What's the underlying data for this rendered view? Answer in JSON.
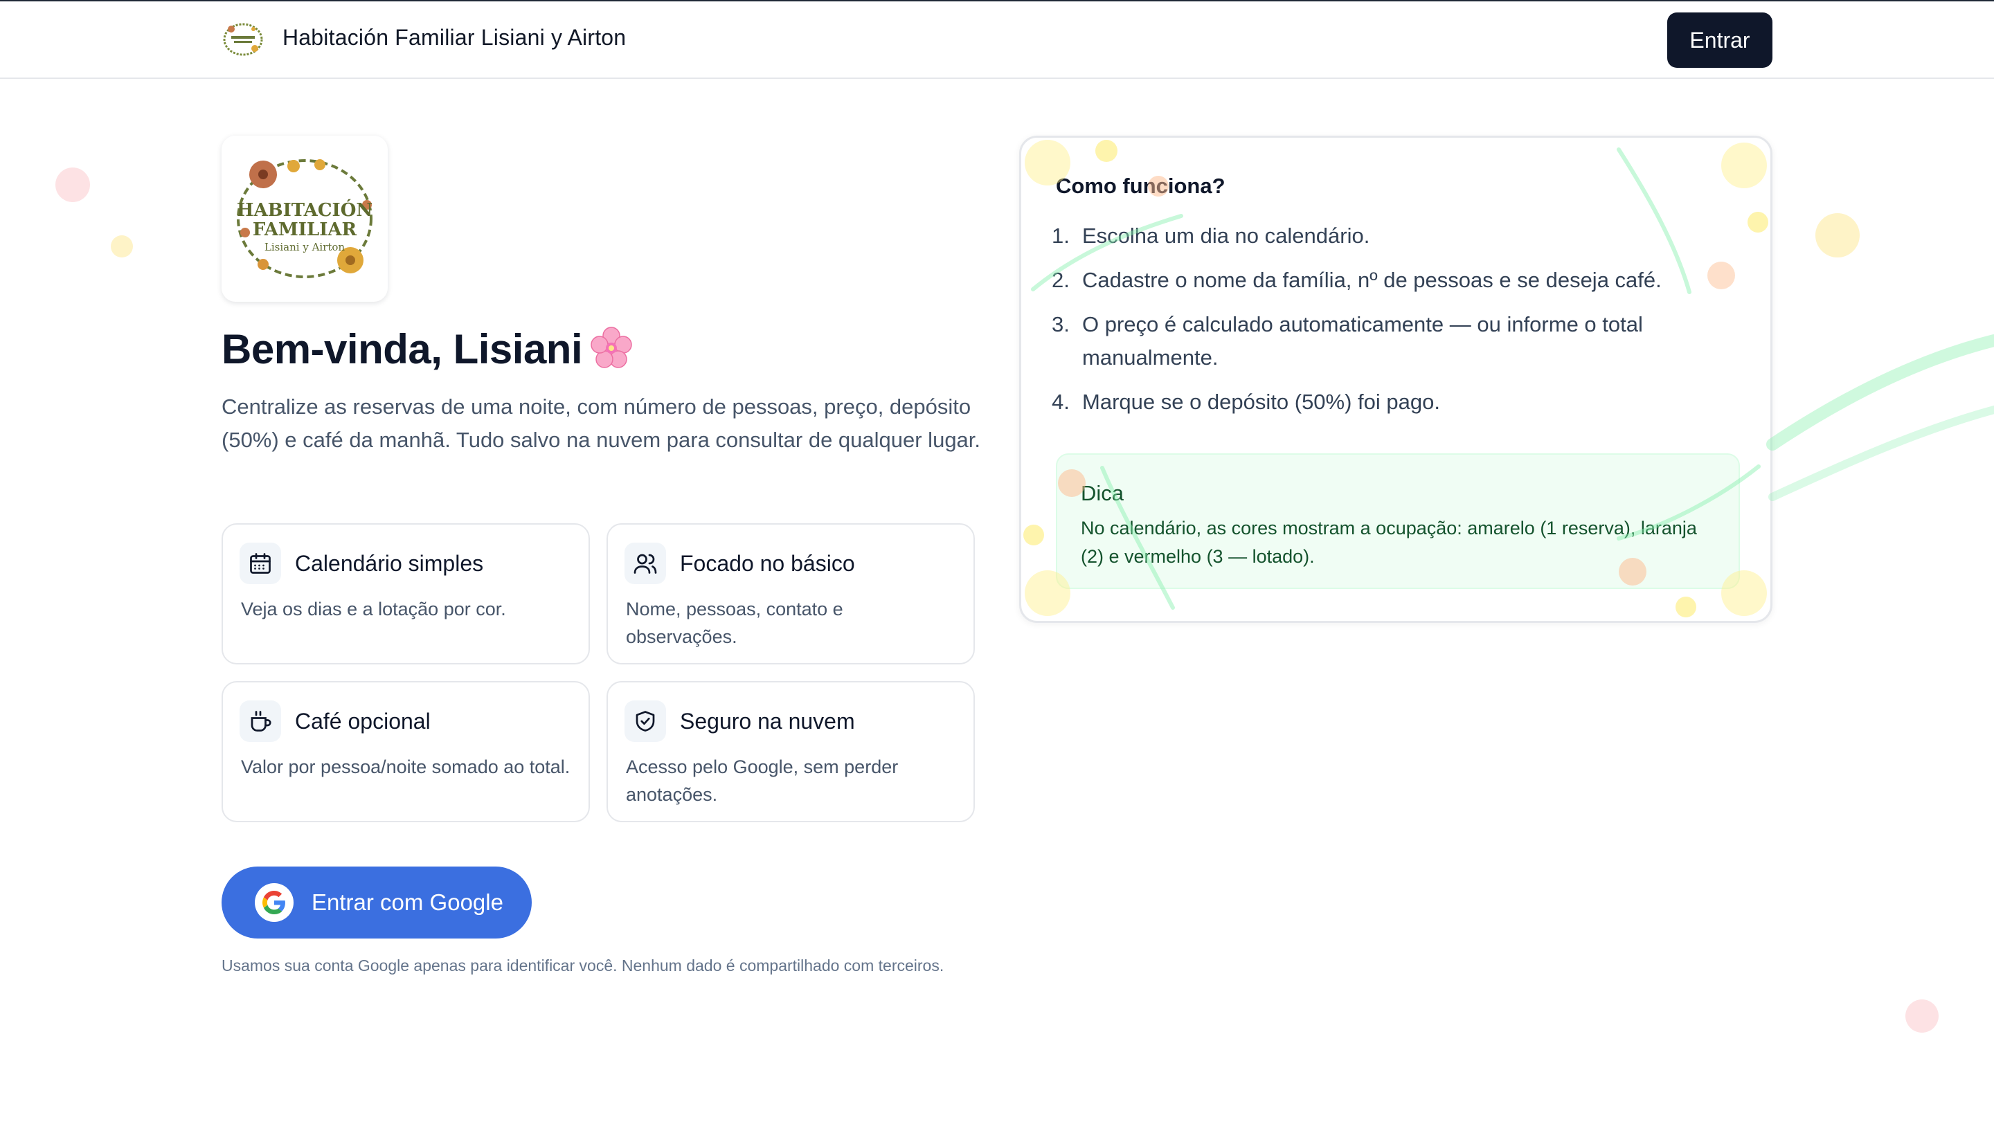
{
  "header": {
    "brand": "Habitación Familiar Lisiani y Airton",
    "enter_label": "Entrar"
  },
  "hero": {
    "logo_text": {
      "line1": "HABITACIÓN",
      "line2": "FAMILIAR",
      "line3": "Lisiani y Airton"
    },
    "welcome": "Bem-vinda, Lisiani",
    "welcome_emoji": "cherry-blossom-icon",
    "intro": "Centralize as reservas de uma noite, com número de pessoas, preço, depósito (50%) e café da manhã. Tudo salvo na nuvem para consultar de qualquer lugar."
  },
  "features": [
    {
      "icon": "calendar-icon",
      "title": "Calendário simples",
      "desc": "Veja os dias e a lotação por cor."
    },
    {
      "icon": "users-icon",
      "title": "Focado no básico",
      "desc": "Nome, pessoas, contato e observações."
    },
    {
      "icon": "coffee-icon",
      "title": "Café opcional",
      "desc": "Valor por pessoa/noite somado ao total."
    },
    {
      "icon": "shield-check-icon",
      "title": "Seguro na nuvem",
      "desc": "Acesso pelo Google, sem perder anotações."
    }
  ],
  "google_button": {
    "label": "Entrar com Google",
    "icon": "google-icon"
  },
  "disclaimer": "Usamos sua conta Google apenas para identificar você. Nenhum dado é compartilhado com terceiros.",
  "how_it_works": {
    "title": "Como funciona?",
    "steps": [
      {
        "num": "1.",
        "text": "Escolha um dia no calendário."
      },
      {
        "num": "2.",
        "text": "Cadastre o nome da família, nº de pessoas e se deseja café."
      },
      {
        "num": "3.",
        "text": "O preço é calculado automaticamente — ou informe o total manualmente."
      },
      {
        "num": "4.",
        "text": "Marque se o depósito (50%) foi pago."
      }
    ],
    "tip_title": "Dica",
    "tip_text": "No calendário, as cores mostram a ocupação: amarelo (1 reserva), laranja (2) e vermelho (3 — lotado)."
  },
  "colors": {
    "primary_dark": "#0f172a",
    "google_blue": "#3b6fe0",
    "tip_bg": "#f0fdf4"
  }
}
